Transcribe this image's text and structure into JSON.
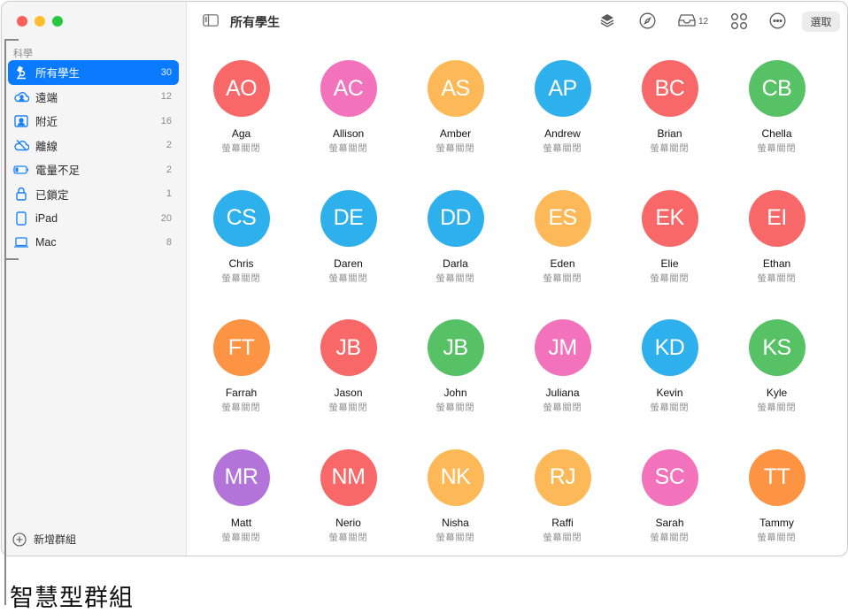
{
  "window": {
    "traffic_lights": [
      {
        "name": "close",
        "color": "#fe5f57"
      },
      {
        "name": "minimize",
        "color": "#febc2e"
      },
      {
        "name": "zoom",
        "color": "#28c840"
      }
    ]
  },
  "sidebar": {
    "section_title": "科學",
    "items": [
      {
        "id": "all-students",
        "label": "所有學生",
        "count": "30",
        "icon": "microscope-icon",
        "active": true
      },
      {
        "id": "remote",
        "label": "遠端",
        "count": "12",
        "icon": "cloud-person-icon"
      },
      {
        "id": "nearby",
        "label": "附近",
        "count": "16",
        "icon": "person-frame-icon"
      },
      {
        "id": "offline",
        "label": "離線",
        "count": "2",
        "icon": "cloud-slash-icon"
      },
      {
        "id": "low-battery",
        "label": "電量不足",
        "count": "2",
        "icon": "battery-low-icon"
      },
      {
        "id": "locked",
        "label": "已鎖定",
        "count": "1",
        "icon": "lock-icon"
      },
      {
        "id": "ipad",
        "label": "iPad",
        "count": "20",
        "icon": "ipad-icon"
      },
      {
        "id": "mac",
        "label": "Mac",
        "count": "8",
        "icon": "laptop-icon"
      }
    ],
    "add_group_label": "新增群組"
  },
  "toolbar": {
    "title": "所有學生",
    "inbox_count": "12",
    "select_label": "選取",
    "icons": [
      "sidebar-toggle-icon",
      "layers-icon",
      "compass-icon",
      "inbox-icon",
      "apps-grid-icon",
      "more-icon"
    ]
  },
  "students": [
    {
      "initials": "AO",
      "name": "Aga",
      "status": "螢幕關閉",
      "color": "#f86868"
    },
    {
      "initials": "AC",
      "name": "Allison",
      "status": "螢幕關閉",
      "color": "#f272bb"
    },
    {
      "initials": "AS",
      "name": "Amber",
      "status": "螢幕關閉",
      "color": "#fdb857"
    },
    {
      "initials": "AP",
      "name": "Andrew",
      "status": "螢幕關閉",
      "color": "#2eb0ec"
    },
    {
      "initials": "BC",
      "name": "Brian",
      "status": "螢幕關閉",
      "color": "#f86868"
    },
    {
      "initials": "CB",
      "name": "Chella",
      "status": "螢幕關閉",
      "color": "#57c166"
    },
    {
      "initials": "CS",
      "name": "Chris",
      "status": "螢幕關閉",
      "color": "#2eb0ec"
    },
    {
      "initials": "DE",
      "name": "Daren",
      "status": "螢幕關閉",
      "color": "#2eb0ec"
    },
    {
      "initials": "DD",
      "name": "Darla",
      "status": "螢幕關閉",
      "color": "#2eb0ec"
    },
    {
      "initials": "ES",
      "name": "Eden",
      "status": "螢幕關閉",
      "color": "#fdb857"
    },
    {
      "initials": "EK",
      "name": "Elie",
      "status": "螢幕關閉",
      "color": "#f86868"
    },
    {
      "initials": "EI",
      "name": "Ethan",
      "status": "螢幕關閉",
      "color": "#f86868"
    },
    {
      "initials": "FT",
      "name": "Farrah",
      "status": "螢幕關閉",
      "color": "#fd9444"
    },
    {
      "initials": "JB",
      "name": "Jason",
      "status": "螢幕關閉",
      "color": "#f86868"
    },
    {
      "initials": "JB",
      "name": "John",
      "status": "螢幕關閉",
      "color": "#57c166"
    },
    {
      "initials": "JM",
      "name": "Juliana",
      "status": "螢幕關閉",
      "color": "#f272bb"
    },
    {
      "initials": "KD",
      "name": "Kevin",
      "status": "螢幕關閉",
      "color": "#2eb0ec"
    },
    {
      "initials": "KS",
      "name": "Kyle",
      "status": "螢幕關閉",
      "color": "#57c166"
    },
    {
      "initials": "MR",
      "name": "Matt",
      "status": "螢幕關閉",
      "color": "#b374da"
    },
    {
      "initials": "NM",
      "name": "Nerio",
      "status": "螢幕關閉",
      "color": "#f86868"
    },
    {
      "initials": "NK",
      "name": "Nisha",
      "status": "螢幕關閉",
      "color": "#fdb857"
    },
    {
      "initials": "RJ",
      "name": "Raffi",
      "status": "螢幕關閉",
      "color": "#fdb857"
    },
    {
      "initials": "SC",
      "name": "Sarah",
      "status": "螢幕關閉",
      "color": "#f272bb"
    },
    {
      "initials": "TT",
      "name": "Tammy",
      "status": "螢幕關閉",
      "color": "#fd9444"
    }
  ],
  "callout": {
    "label": "智慧型群組"
  }
}
